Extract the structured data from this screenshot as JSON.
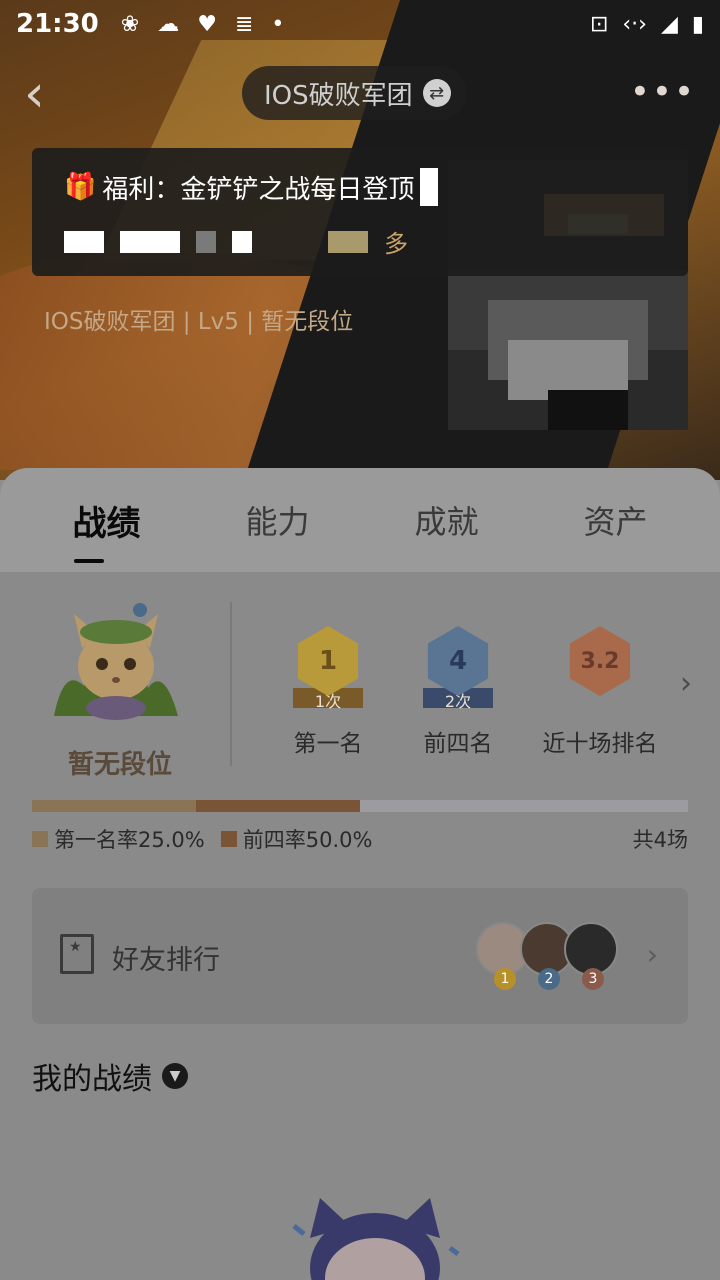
{
  "status_bar": {
    "time": "21:30",
    "left_icons": [
      "leaf-icon",
      "cloud-icon",
      "heart-pulse-icon",
      "database-icon",
      "dot-icon"
    ],
    "right_icons": [
      "cast-icon",
      "code-arrows-icon",
      "signal-icon",
      "battery-icon"
    ]
  },
  "nav": {
    "back_glyph": "‹",
    "team_name": "IOS破败军团",
    "swap_glyph": "⇄",
    "more_glyph": "•••"
  },
  "toast": {
    "title": "福利：金铲铲之战每日登顶",
    "more_text": "多"
  },
  "player": {
    "subtitle": "IOS破败军团 | Lv5 | 暂无段位"
  },
  "tabs": [
    {
      "label": "战绩",
      "active": true
    },
    {
      "label": "能力",
      "active": false
    },
    {
      "label": "成就",
      "active": false
    },
    {
      "label": "资产",
      "active": false
    }
  ],
  "rank": {
    "label": "暂无段位"
  },
  "medals": [
    {
      "value": "1",
      "ribbon": "1次",
      "label": "第一名",
      "color": "#b89a3a"
    },
    {
      "value": "4",
      "ribbon": "2次",
      "label": "前四名",
      "color": "#5a7494"
    },
    {
      "value": "3.2",
      "ribbon": "",
      "label": "近十场排名",
      "color": "#a86a4a"
    }
  ],
  "stats": {
    "first_rate_label": "第一名率25.0%",
    "top4_rate_label": "前四率50.0%",
    "first_rate": 0.25,
    "top4_rate": 0.5,
    "total_label": "共4场",
    "first_color": "#8a7456",
    "top4_color": "#7a5436"
  },
  "friend_rank": {
    "title": "好友排行",
    "ranks": [
      "1",
      "2",
      "3"
    ],
    "rank_colors": [
      "#b8902a",
      "#4a6a8a",
      "#8a5a4a"
    ]
  },
  "my_record": {
    "title": "我的战绩"
  }
}
